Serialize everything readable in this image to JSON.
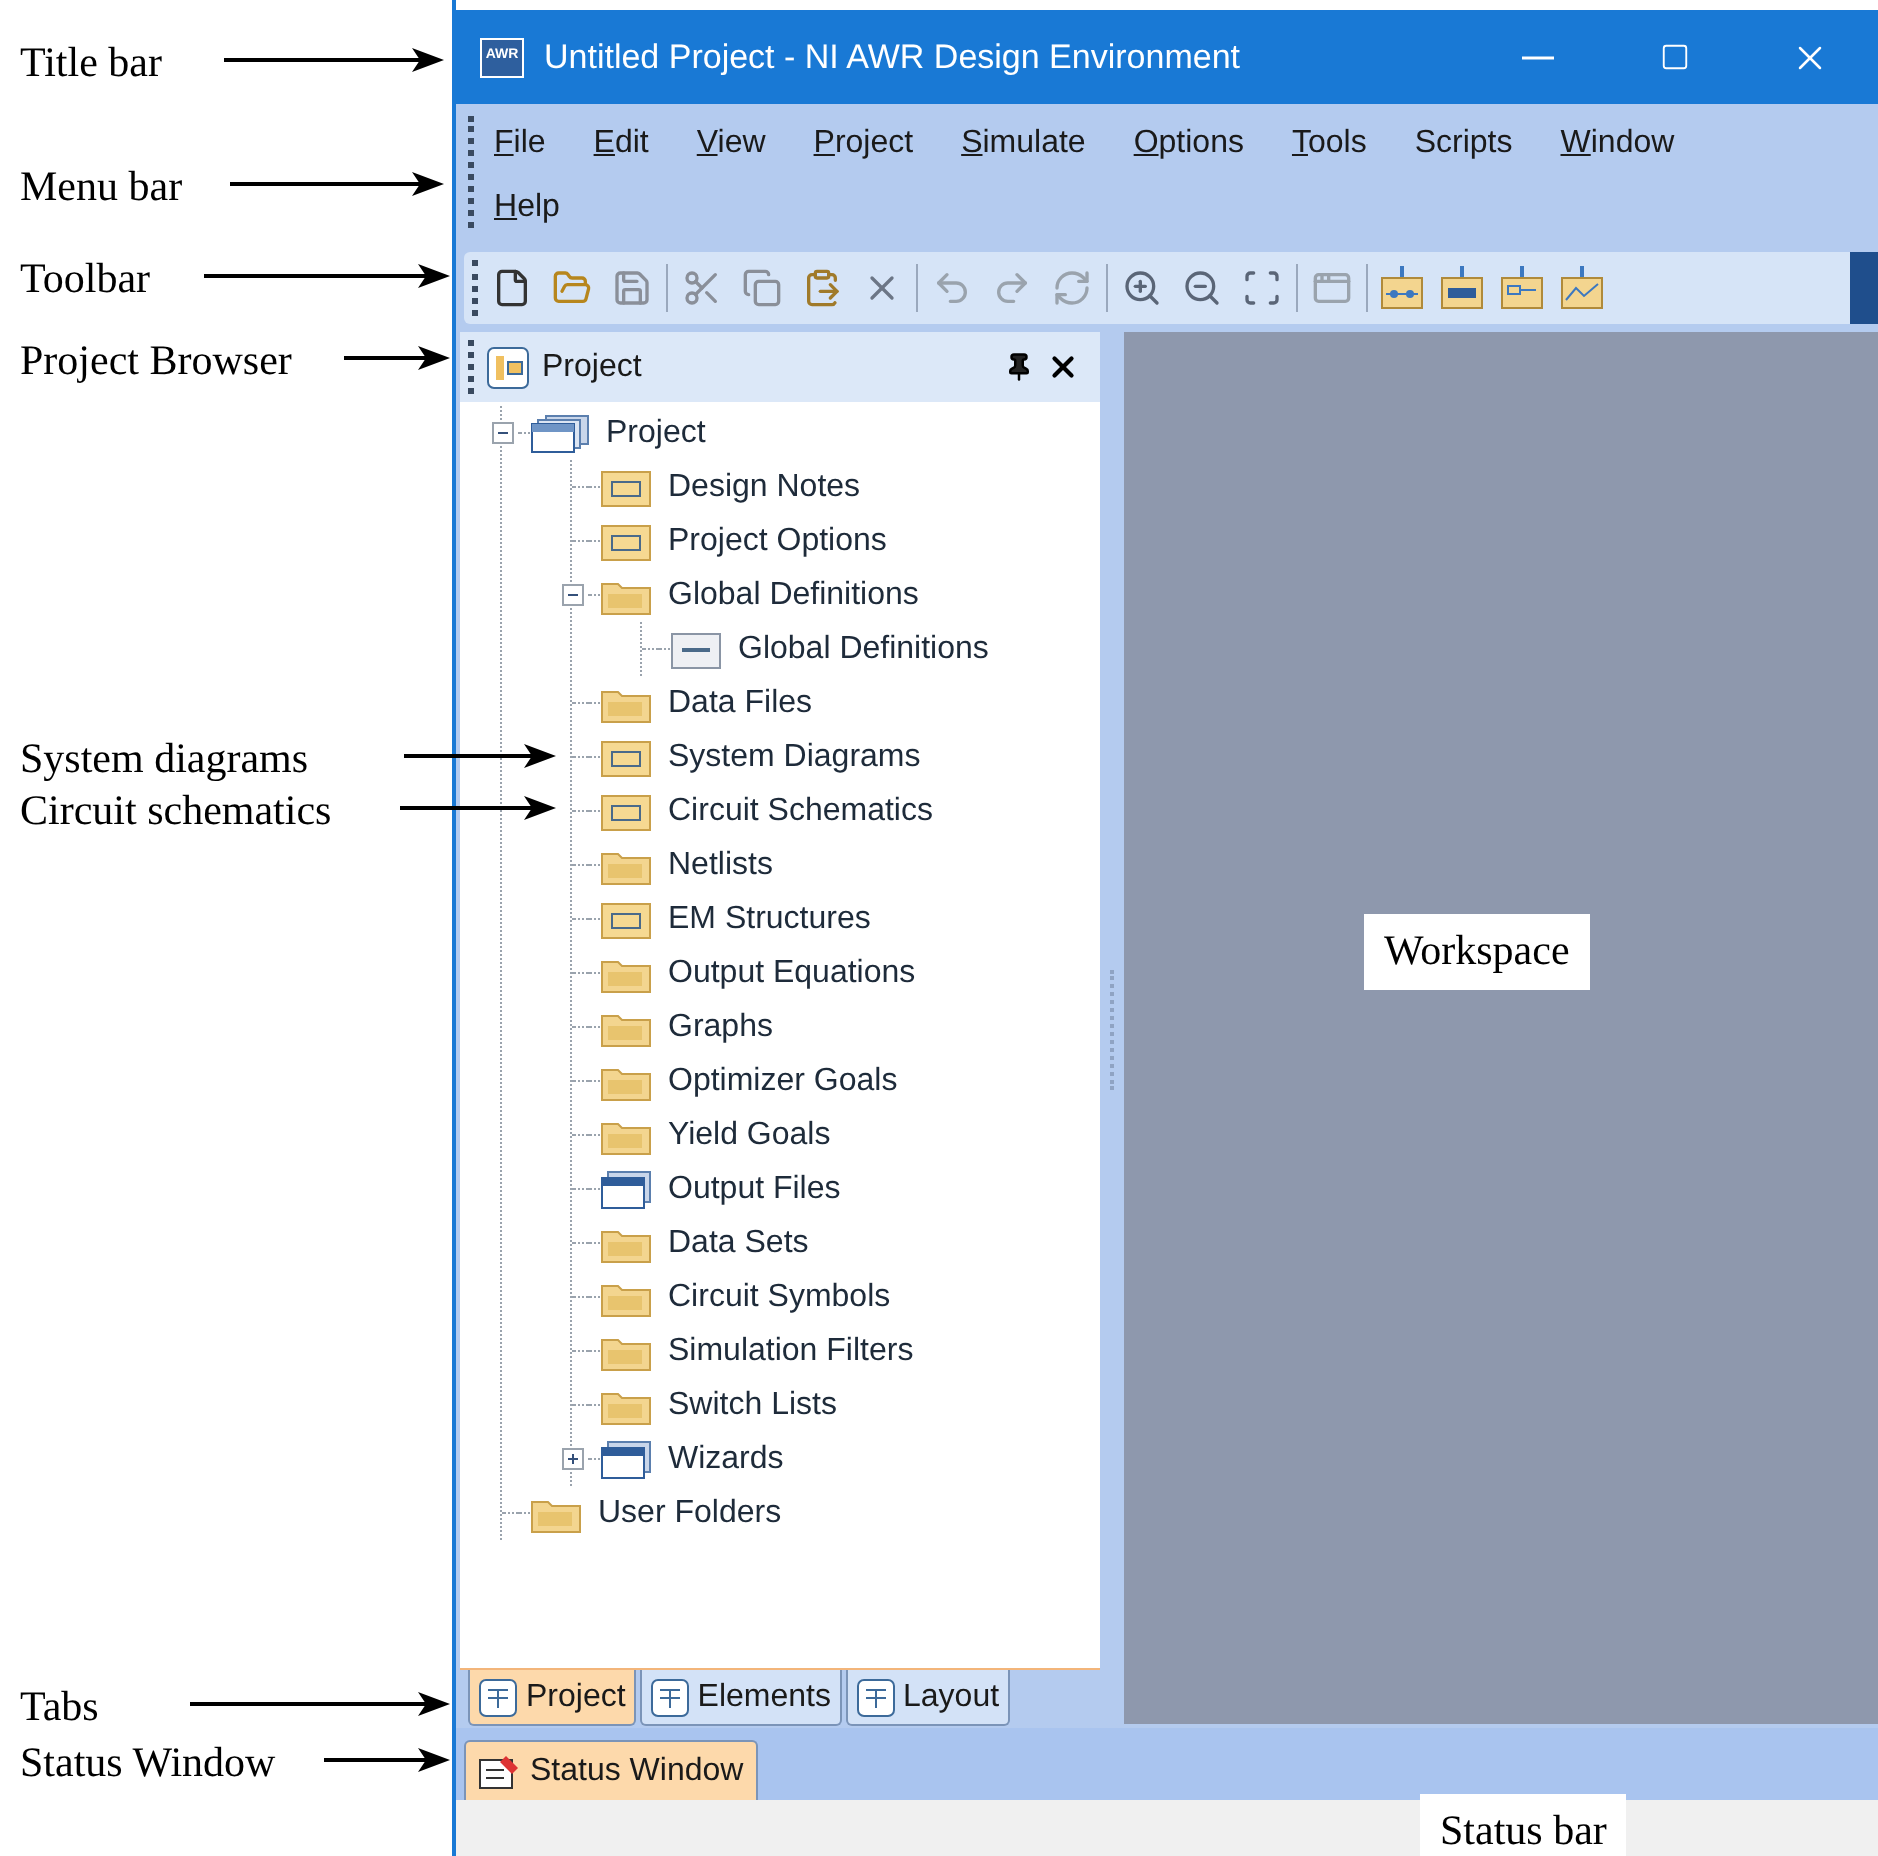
{
  "annotations": [
    {
      "text": "Title bar"
    },
    {
      "text": "Menu bar"
    },
    {
      "text": "Toolbar"
    },
    {
      "text": "Project Browser"
    },
    {
      "text": "System diagrams"
    },
    {
      "text": "Circuit schematics"
    },
    {
      "text": "Tabs"
    },
    {
      "text": "Status Window"
    },
    {
      "text": "Workspace"
    },
    {
      "text": "Status bar"
    }
  ],
  "window": {
    "app_icon_text": "AWR",
    "title": "Untitled Project - NI AWR Design Environment"
  },
  "menu": [
    {
      "label": "File",
      "underlined": true
    },
    {
      "label": "Edit",
      "underlined": true
    },
    {
      "label": "View",
      "underlined": true
    },
    {
      "label": "Project",
      "underlined": true
    },
    {
      "label": "Simulate",
      "underlined": true
    },
    {
      "label": "Options",
      "underlined": true
    },
    {
      "label": "Tools",
      "underlined": true
    },
    {
      "label": "Scripts",
      "underlined": false
    },
    {
      "label": "Window",
      "underlined": true
    },
    {
      "label": "Help",
      "underlined": true
    }
  ],
  "project_browser": {
    "title": "Project",
    "tree": [
      {
        "label": "Project",
        "kind": "project",
        "expanded": true,
        "children": [
          {
            "label": "Design Notes",
            "kind": "card"
          },
          {
            "label": "Project Options",
            "kind": "card"
          },
          {
            "label": "Global Definitions",
            "kind": "folder",
            "expanded": true,
            "children": [
              {
                "label": "Global Definitions",
                "kind": "page"
              }
            ]
          },
          {
            "label": "Data Files",
            "kind": "folder"
          },
          {
            "label": "System Diagrams",
            "kind": "card"
          },
          {
            "label": "Circuit Schematics",
            "kind": "card"
          },
          {
            "label": "Netlists",
            "kind": "folder"
          },
          {
            "label": "EM Structures",
            "kind": "card"
          },
          {
            "label": "Output Equations",
            "kind": "folder"
          },
          {
            "label": "Graphs",
            "kind": "folder"
          },
          {
            "label": "Optimizer Goals",
            "kind": "folder"
          },
          {
            "label": "Yield Goals",
            "kind": "folder"
          },
          {
            "label": "Output Files",
            "kind": "window"
          },
          {
            "label": "Data Sets",
            "kind": "folder"
          },
          {
            "label": "Circuit Symbols",
            "kind": "folder"
          },
          {
            "label": "Simulation Filters",
            "kind": "folder"
          },
          {
            "label": "Switch Lists",
            "kind": "folder"
          },
          {
            "label": "Wizards",
            "kind": "window",
            "expanded": false
          }
        ]
      },
      {
        "label": "User Folders",
        "kind": "folder"
      }
    ]
  },
  "browser_tabs": [
    {
      "label": "Project",
      "selected": true
    },
    {
      "label": "Elements",
      "selected": false
    },
    {
      "label": "Layout",
      "selected": false
    }
  ],
  "dock_tabs": [
    {
      "label": "Status Window",
      "selected": true
    }
  ]
}
